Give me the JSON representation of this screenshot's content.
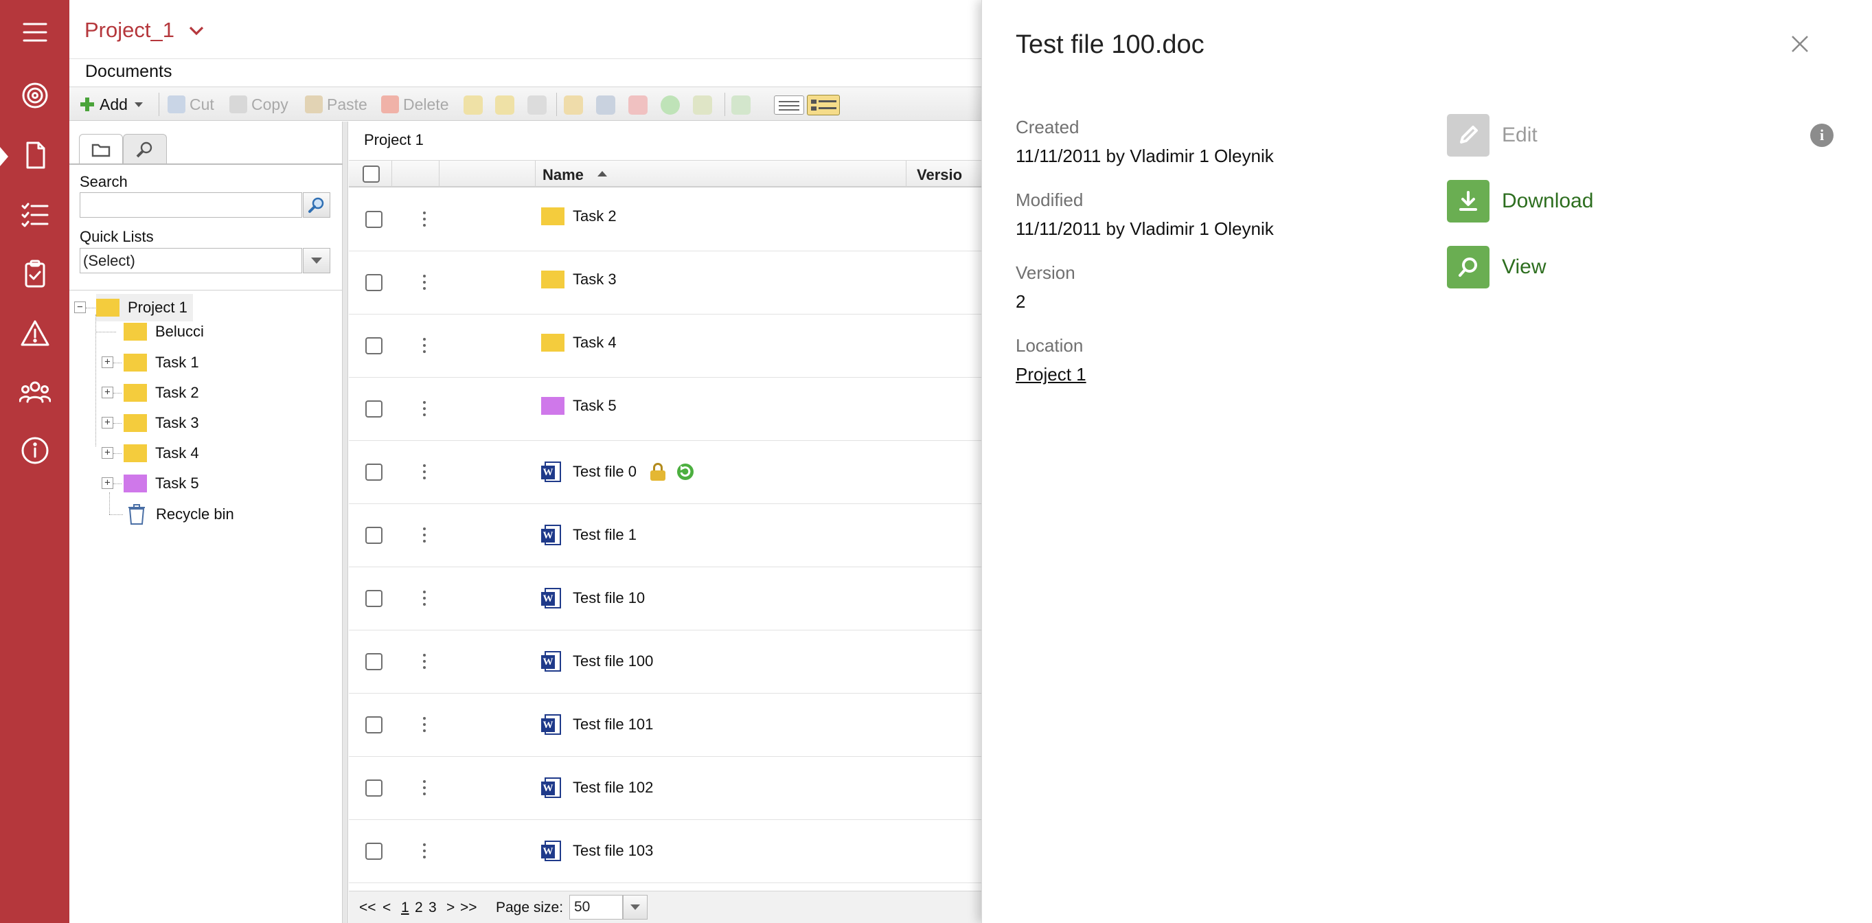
{
  "colors": {
    "brand": "#b5373c",
    "accent_green": "#6aae52",
    "folder_yellow": "#f4cc3d",
    "folder_purple": "#cf78ea",
    "word_blue": "#1f3a8a"
  },
  "rail": {
    "items": [
      {
        "icon": "menu-icon"
      },
      {
        "icon": "target-icon"
      },
      {
        "icon": "document-icon"
      },
      {
        "icon": "checklist-icon"
      },
      {
        "icon": "clipboard-check-icon"
      },
      {
        "icon": "warning-icon"
      },
      {
        "icon": "people-icon"
      },
      {
        "icon": "info-icon"
      }
    ]
  },
  "header": {
    "project_name": "Project_1",
    "section": "Documents"
  },
  "toolbar": {
    "add": "Add",
    "cut": "Cut",
    "copy": "Copy",
    "paste": "Paste",
    "delete": "Delete"
  },
  "tree_pane": {
    "search_label": "Search",
    "search_value": "",
    "quick_lists_label": "Quick Lists",
    "quick_lists_value": "(Select)",
    "root": "Project 1",
    "nodes": [
      {
        "label": "Belucci",
        "color": "yellow",
        "expandable": false
      },
      {
        "label": "Task 1",
        "color": "yellow",
        "expandable": true
      },
      {
        "label": "Task 2",
        "color": "yellow",
        "expandable": true
      },
      {
        "label": "Task 3",
        "color": "yellow",
        "expandable": true
      },
      {
        "label": "Task 4",
        "color": "yellow",
        "expandable": true
      },
      {
        "label": "Task 5",
        "color": "purple",
        "expandable": true
      }
    ],
    "recycle_bin": "Recycle bin"
  },
  "grid": {
    "breadcrumb": "Project 1",
    "columns": {
      "name": "Name",
      "version": "Versio"
    },
    "sort": "ascending",
    "rows": [
      {
        "name": "Task 2",
        "type": "folder",
        "color": "yellow"
      },
      {
        "name": "Task 3",
        "type": "folder",
        "color": "yellow"
      },
      {
        "name": "Task 4",
        "type": "folder",
        "color": "yellow"
      },
      {
        "name": "Task 5",
        "type": "folder",
        "color": "purple"
      },
      {
        "name": "Test file 0",
        "type": "word",
        "locked": true,
        "syncing": true
      },
      {
        "name": "Test file 1",
        "type": "word"
      },
      {
        "name": "Test file 10",
        "type": "word"
      },
      {
        "name": "Test file 100",
        "type": "word"
      },
      {
        "name": "Test file 101",
        "type": "word"
      },
      {
        "name": "Test file 102",
        "type": "word"
      },
      {
        "name": "Test file 103",
        "type": "word"
      }
    ],
    "pager": {
      "first": "<<",
      "prev": "<",
      "pages": [
        "1",
        "2",
        "3"
      ],
      "current_page": "1",
      "next": ">",
      "last": ">>",
      "page_size_label": "Page size:",
      "page_size": "50"
    }
  },
  "detail": {
    "title": "Test file 100.doc",
    "created_label": "Created",
    "created_value": "11/11/2011 by Vladimir 1 Oleynik",
    "modified_label": "Modified",
    "modified_value": "11/11/2011 by Vladimir 1 Oleynik",
    "version_label": "Version",
    "version_value": "2",
    "location_label": "Location",
    "location_value": "Project 1",
    "actions": {
      "edit": "Edit",
      "download": "Download",
      "view": "View"
    }
  }
}
